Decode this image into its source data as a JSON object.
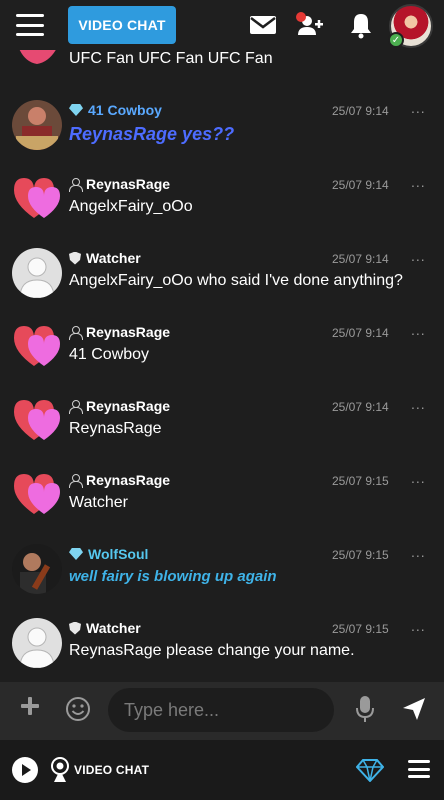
{
  "header": {
    "video_chat_label": "VIDEO CHAT",
    "icons": [
      "menu-icon",
      "envelope-icon",
      "friend-request-icon",
      "bell-icon"
    ]
  },
  "partial_message": {
    "text": "UFC Fan UFC Fan UFC Fan"
  },
  "messages": [
    {
      "user": "41 Cowboy",
      "badge": "diamond",
      "time": "25/07 9:14",
      "text": "ReynasRage yes??",
      "style": "italic-blue",
      "more": "..."
    },
    {
      "user": "ReynasRage",
      "badge": "person",
      "time": "25/07 9:14",
      "text": "AngelxFairy_oOo",
      "style": "",
      "more": "..."
    },
    {
      "user": "Watcher",
      "badge": "shield",
      "time": "25/07 9:14",
      "text": "AngelxFairy_oOo who said I've done anything?",
      "style": "",
      "more": "..."
    },
    {
      "user": "ReynasRage",
      "badge": "person",
      "time": "25/07 9:14",
      "text": "41 Cowboy",
      "style": "",
      "more": "..."
    },
    {
      "user": "ReynasRage",
      "badge": "person",
      "time": "25/07 9:14",
      "text": "ReynasRage",
      "style": "",
      "more": "..."
    },
    {
      "user": "ReynasRage",
      "badge": "person",
      "time": "25/07 9:15",
      "text": "Watcher",
      "style": "",
      "more": "..."
    },
    {
      "user": "WolfSoul",
      "badge": "diamond",
      "time": "25/07 9:15",
      "text": "well fairy is blowing up again",
      "style": "italic-cyan",
      "more": "..."
    },
    {
      "user": "Watcher",
      "badge": "shield",
      "time": "25/07 9:15",
      "text": "ReynasRage please change your name.",
      "style": "",
      "more": "..."
    }
  ],
  "input": {
    "placeholder": "Type here..."
  },
  "footer": {
    "video_chat_label": "VIDEO CHAT"
  },
  "colors": {
    "accent": "#2f9bde",
    "background": "#1e1e1e",
    "username_blue": "#5aa9ff",
    "username_cyan": "#56c7ee",
    "notification_red": "#e53935",
    "online_green": "#4caf50"
  }
}
